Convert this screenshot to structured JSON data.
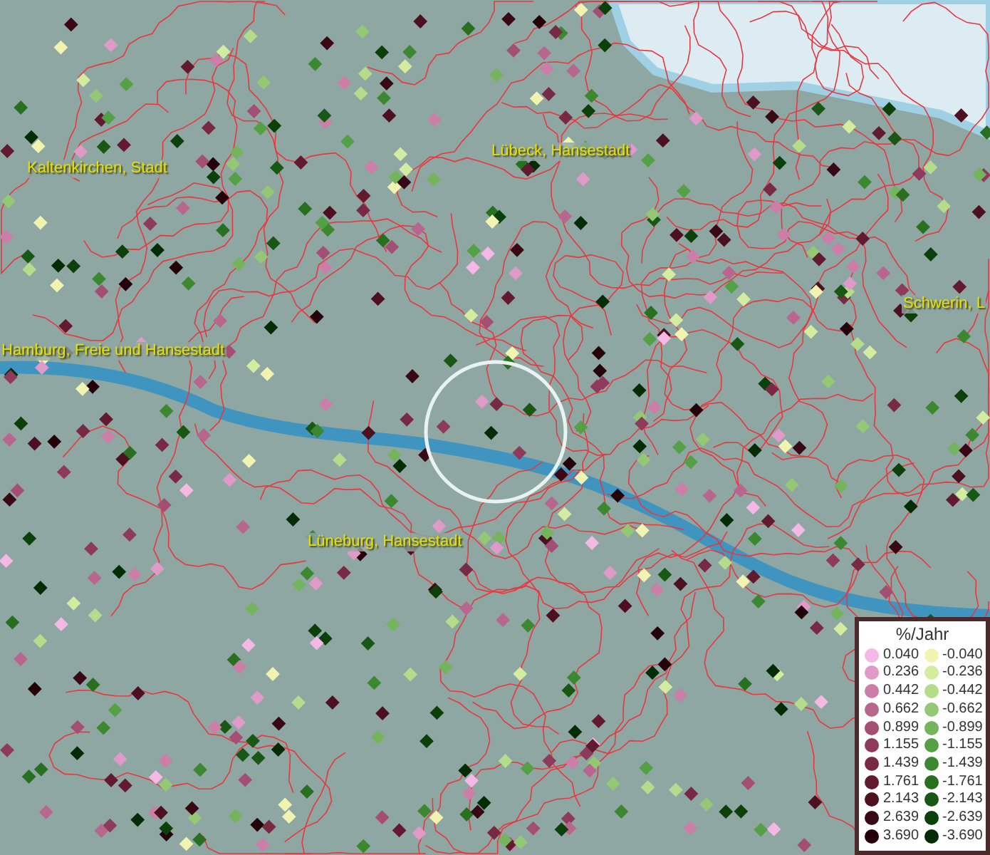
{
  "map": {
    "places": [
      {
        "name": "Kaltenkirchen, Stadt"
      },
      {
        "name": "Lübeck, Hansestadt"
      },
      {
        "name": "Hamburg, Freie und Hansestadt"
      },
      {
        "name": "Lüneburg, Hansestadt"
      },
      {
        "name": "Schwerin, L"
      }
    ]
  },
  "legend": {
    "title": "%/Jahr",
    "positive": [
      {
        "label": "0.040",
        "color": "#f4b8e4"
      },
      {
        "label": "0.236",
        "color": "#e09ac8"
      },
      {
        "label": "0.442",
        "color": "#cc7ea8"
      },
      {
        "label": "0.662",
        "color": "#b8668e"
      },
      {
        "label": "0.899",
        "color": "#a44e74"
      },
      {
        "label": "1.155",
        "color": "#8e3a5a"
      },
      {
        "label": "1.439",
        "color": "#782a44"
      },
      {
        "label": "1.761",
        "color": "#621a30"
      },
      {
        "label": "2.143",
        "color": "#4c1020"
      },
      {
        "label": "2.639",
        "color": "#380814"
      },
      {
        "label": "3.690",
        "color": "#24020a"
      }
    ],
    "negative": [
      {
        "label": "-0.040",
        "color": "#f0f4b0"
      },
      {
        "label": "-0.236",
        "color": "#d4eca0"
      },
      {
        "label": "-0.442",
        "color": "#b4dc8a"
      },
      {
        "label": "-0.662",
        "color": "#94c874"
      },
      {
        "label": "-0.899",
        "color": "#74b45c"
      },
      {
        "label": "-1.155",
        "color": "#54a044"
      },
      {
        "label": "-1.439",
        "color": "#3c8830"
      },
      {
        "label": "-1.761",
        "color": "#287020"
      },
      {
        "label": "-2.143",
        "color": "#185814"
      },
      {
        "label": "-2.639",
        "color": "#0c400a"
      },
      {
        "label": "-3.690",
        "color": "#042c04"
      }
    ]
  }
}
